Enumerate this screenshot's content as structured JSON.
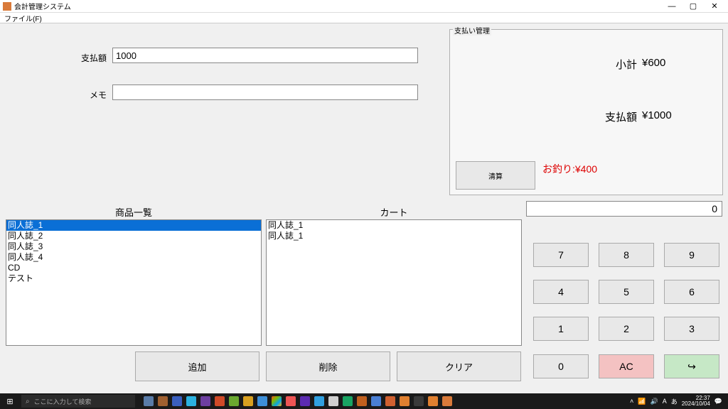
{
  "window": {
    "title": "会計管理システム",
    "minimize": "—",
    "maximize": "▢",
    "close": "✕"
  },
  "menu": {
    "file": "ファイル(F)"
  },
  "form": {
    "pay_label": "支払額",
    "pay_value": "1000",
    "memo_label": "メモ",
    "memo_value": ""
  },
  "group": {
    "title": "支払い管理",
    "subtotal_label": "小計",
    "subtotal_value": "¥600",
    "paid_label": "支払額",
    "paid_value": "¥1000",
    "change_text": "お釣り:¥400",
    "settle": "清算"
  },
  "lists": {
    "products_label": "商品一覧",
    "cart_label": "カート",
    "products": [
      "同人誌_1",
      "同人誌_2",
      "同人誌_3",
      "同人誌_4",
      "CD",
      "テスト"
    ],
    "cart": [
      "同人誌_1",
      "同人誌_1"
    ]
  },
  "actions": {
    "add": "追加",
    "del": "削除",
    "clear": "クリア"
  },
  "calc": {
    "display": "0",
    "k7": "7",
    "k8": "8",
    "k9": "9",
    "k4": "4",
    "k5": "5",
    "k6": "6",
    "k1": "1",
    "k2": "2",
    "k3": "3",
    "k0": "0",
    "ac": "AC",
    "enter": "↪"
  },
  "taskbar": {
    "start": "⊞",
    "search_placeholder": "ここに入力して検索",
    "time": "22:37",
    "date": "2024/10/04",
    "tray_up": "˄",
    "tray_ime": "あ",
    "tray_a": "A"
  }
}
